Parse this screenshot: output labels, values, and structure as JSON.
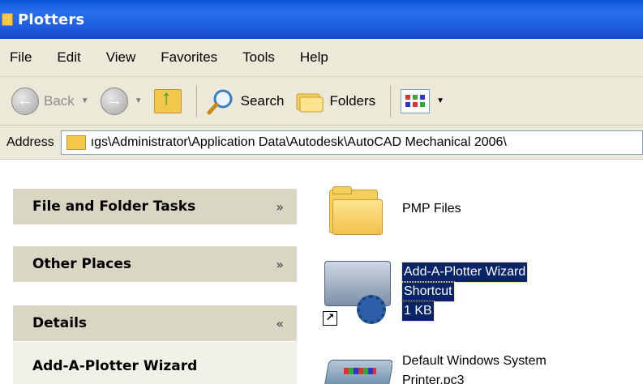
{
  "window": {
    "title": "Plotters"
  },
  "menu": [
    "File",
    "Edit",
    "View",
    "Favorites",
    "Tools",
    "Help"
  ],
  "toolbar": {
    "back_label": "Back",
    "search_label": "Search",
    "folders_label": "Folders"
  },
  "address": {
    "label": "Address",
    "value": "ıgs\\Administrator\\Application Data\\Autodesk\\AutoCAD Mechanical 2006\\"
  },
  "tasks": {
    "file_folder_tasks": "File and Folder Tasks",
    "other_places": "Other Places",
    "details": "Details",
    "details_name": "Add-A-Plotter Wizard"
  },
  "files": [
    {
      "name": "PMP Files",
      "icon": "folder-icon"
    },
    {
      "name_line1": "Add-A-Plotter Wizard",
      "name_line2": "Shortcut",
      "name_line3": "1 KB",
      "icon": "plotter-wizard-icon",
      "selected": true
    },
    {
      "name_line1": "Default Windows System",
      "name_line2": "Printer.pc3",
      "icon": "printer-icon"
    }
  ],
  "colors": {
    "title_bar": "#1d5ee0",
    "selection": "#0a246a",
    "panel_header": "#d9d6c4"
  }
}
